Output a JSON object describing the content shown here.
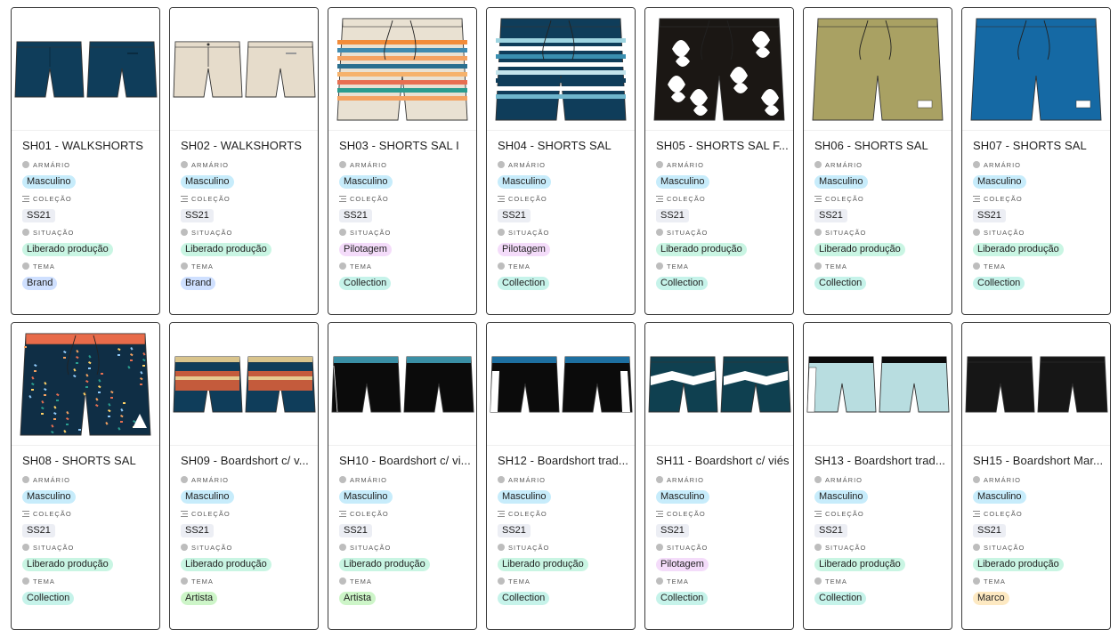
{
  "labels": {
    "armario": "ARMÁRIO",
    "colecao": "COLEÇÃO",
    "situacao": "SITUAÇÃO",
    "tema": "TEMA"
  },
  "cards": [
    {
      "title": "SH01 - WALKSHORTS",
      "armario": "Masculino",
      "colecao": "SS21",
      "situacao": "Liberado produção",
      "tema": "Brand",
      "art": "walk-navy",
      "sit": "lib",
      "tem": "brand"
    },
    {
      "title": "SH02 - WALKSHORTS",
      "armario": "Masculino",
      "colecao": "SS21",
      "situacao": "Liberado produção",
      "tema": "Brand",
      "art": "walk-beige",
      "sit": "lib",
      "tem": "brand"
    },
    {
      "title": "SH03 - SHORTS SAL I",
      "armario": "Masculino",
      "colecao": "SS21",
      "situacao": "Pilotagem",
      "tema": "Collection",
      "art": "stripe-orange",
      "sit": "pil",
      "tem": "collection"
    },
    {
      "title": "SH04 - SHORTS SAL",
      "armario": "Masculino",
      "colecao": "SS21",
      "situacao": "Pilotagem",
      "tema": "Collection",
      "art": "stripe-teal",
      "sit": "pil",
      "tem": "collection"
    },
    {
      "title": "SH05 - SHORTS SAL F...",
      "armario": "Masculino",
      "colecao": "SS21",
      "situacao": "Liberado produção",
      "tema": "Collection",
      "art": "leaf-black",
      "sit": "lib",
      "tem": "collection"
    },
    {
      "title": "SH06 - SHORTS SAL",
      "armario": "Masculino",
      "colecao": "SS21",
      "situacao": "Liberado produção",
      "tema": "Collection",
      "art": "solid-olive",
      "sit": "lib",
      "tem": "collection"
    },
    {
      "title": "SH07 - SHORTS SAL",
      "armario": "Masculino",
      "colecao": "SS21",
      "situacao": "Liberado produção",
      "tema": "Collection",
      "art": "solid-blue",
      "sit": "lib",
      "tem": "collection"
    },
    {
      "title": "SH08 - SHORTS SAL",
      "armario": "Masculino",
      "colecao": "SS21",
      "situacao": "Liberado produção",
      "tema": "Collection",
      "art": "dots-navy",
      "sit": "lib",
      "tem": "collection"
    },
    {
      "title": "SH09 - Boardshort c/ v...",
      "armario": "Masculino",
      "colecao": "SS21",
      "situacao": "Liberado produção",
      "tema": "Artista",
      "art": "board-pattern",
      "sit": "lib",
      "tem": "artista"
    },
    {
      "title": "SH10 - Boardshort c/ vi...",
      "armario": "Masculino",
      "colecao": "SS21",
      "situacao": "Liberado produção",
      "tema": "Artista",
      "art": "board-black-band",
      "sit": "lib",
      "tem": "artista"
    },
    {
      "title": "SH12 - Boardshort trad...",
      "armario": "Masculino",
      "colecao": "SS21",
      "situacao": "Liberado produção",
      "tema": "Collection",
      "art": "board-black-side",
      "sit": "lib",
      "tem": "collection"
    },
    {
      "title": "SH11 - Boardshort c/ viés",
      "armario": "Masculino",
      "colecao": "SS21",
      "situacao": "Pilotagem",
      "tema": "Collection",
      "art": "board-teal-chevron",
      "sit": "pil",
      "tem": "collection"
    },
    {
      "title": "SH13 - Boardshort trad...",
      "armario": "Masculino",
      "colecao": "SS21",
      "situacao": "Liberado produção",
      "tema": "Collection",
      "art": "board-mint",
      "sit": "lib",
      "tem": "collection"
    },
    {
      "title": "SH15 - Boardshort Mar...",
      "armario": "Masculino",
      "colecao": "SS21",
      "situacao": "Liberado produção",
      "tema": "Marco",
      "art": "board-black",
      "sit": "lib",
      "tem": "marco"
    }
  ]
}
